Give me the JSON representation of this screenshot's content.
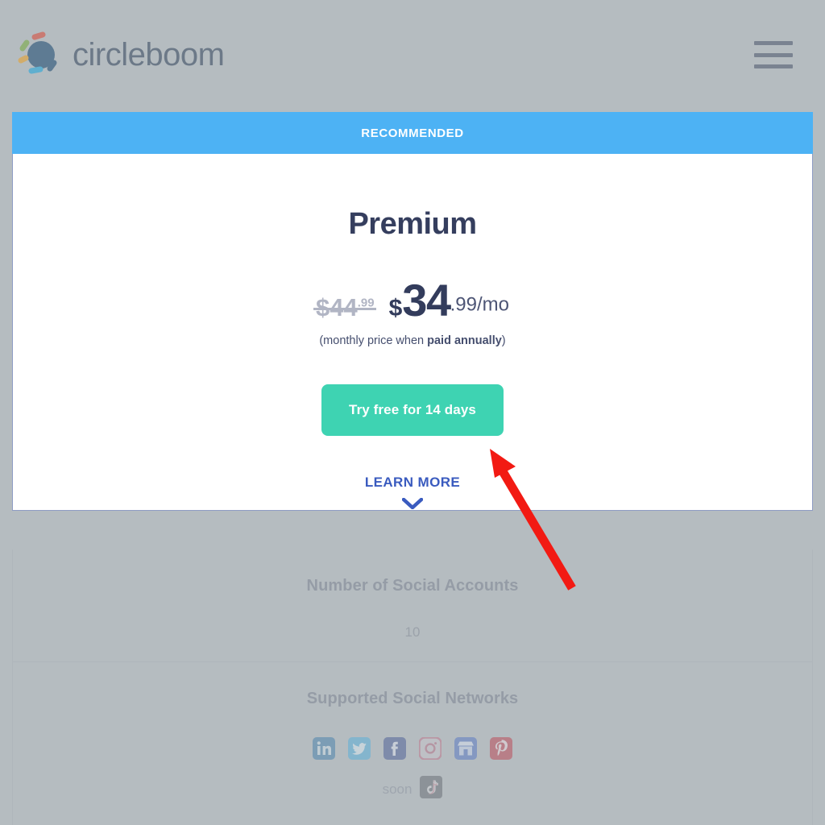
{
  "header": {
    "brand_name": "circleboom",
    "logo_icon": "circleboom-logo-icon",
    "menu_icon": "hamburger-menu-icon"
  },
  "card": {
    "ribbon_label": "RECOMMENDED",
    "plan_title": "Premium",
    "price": {
      "old_currency": "$",
      "old_amount": "44",
      "old_cents": ".99",
      "currency": "$",
      "amount": "34",
      "cents": ".99/mo"
    },
    "price_note_prefix": "(monthly price when ",
    "price_note_bold": "paid annually",
    "price_note_suffix": ")",
    "cta_label": "Try free for 14 days",
    "learn_more_label": "LEARN MORE",
    "learn_more_icon": "chevron-down-icon"
  },
  "features": [
    {
      "title": "Number of Social Accounts",
      "value": "10"
    },
    {
      "title": "Supported Social Networks",
      "networks": [
        {
          "name": "linkedin-icon",
          "color": "#3878a8"
        },
        {
          "name": "twitter-icon",
          "color": "#4aaede"
        },
        {
          "name": "facebook-icon",
          "color": "#3d5090"
        },
        {
          "name": "instagram-icon",
          "color": "#c06a84"
        },
        {
          "name": "google-business-icon",
          "color": "#4a6dc4"
        },
        {
          "name": "pinterest-icon",
          "color": "#bc3545"
        }
      ],
      "soon_label": "soon",
      "soon_icon": "tiktok-icon"
    }
  ],
  "annotation": {
    "arrow_icon": "red-arrow-annotation",
    "color": "#f21a13"
  },
  "colors": {
    "page_background": "#b5bcc0",
    "ribbon": "#4db2f4",
    "cta": "#3ed3b2",
    "title_text": "#353e5e",
    "link": "#3a5bbf",
    "old_price": "#b1b5c4"
  }
}
